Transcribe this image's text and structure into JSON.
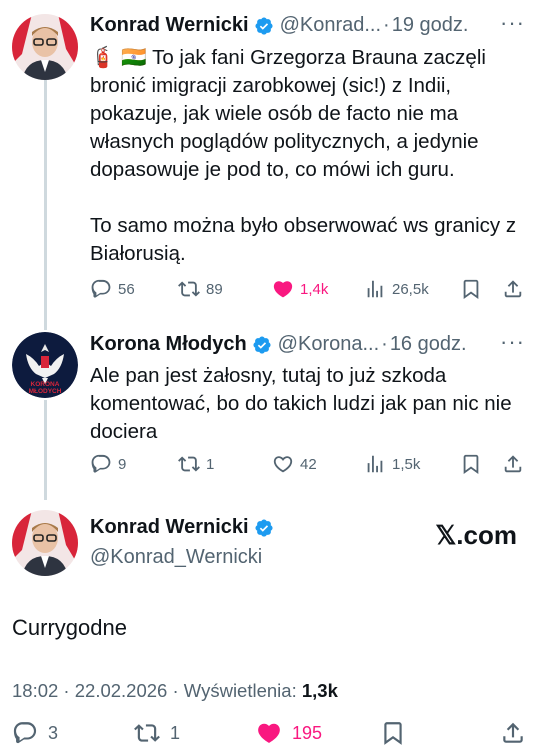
{
  "colors": {
    "text": "#0f1419",
    "muted": "#536471",
    "like": "#f91880",
    "verified": "#1d9bf0",
    "thread_line": "#cfd9de"
  },
  "tweet1": {
    "display_name": "Konrad Wernicki",
    "handle": "@Konrad...",
    "separator": "·",
    "time": "19 godz.",
    "flags": "🧯 🇮🇳",
    "text_line1": "To jak fani Grzegorza Brauna zaczęli bronić imigracji zarobkowej (sic!) z Indii, pokazuje, jak wiele osób de facto nie ma własnych poglądów politycznych, a jedynie dopasowuje je pod to, co mówi ich guru.",
    "text_line2": "To samo można było obserwować ws granicy z Białorusią.",
    "replies": "56",
    "retweets": "89",
    "likes": "1,4k",
    "views": "26,5k",
    "avatar_icon": "person-avatar"
  },
  "tweet2": {
    "display_name": "Korona Młodych",
    "handle": "@Korona...",
    "separator": "·",
    "time": "16 godz.",
    "text": "Ale pan jest żałosny, tutaj to już szkoda komentować, bo do takich ludzi jak pan nic nie dociera",
    "replies": "9",
    "retweets": "1",
    "likes": "42",
    "views": "1,5k",
    "avatar_icon": "eagle-crest-avatar",
    "avatar_text": "KORONA MŁODYCH"
  },
  "main_tweet": {
    "display_name": "Konrad Wernicki",
    "handle": "@Konrad_Wernicki",
    "site": "𝕏.com",
    "text": "Currygodne",
    "time": "18:02 · 22.02.2026 · ",
    "views_label": "Wyświetlenia: ",
    "views": "1,3k",
    "replies": "3",
    "retweets": "1",
    "likes": "195"
  },
  "icons": [
    "reply-icon",
    "retweet-icon",
    "like-icon",
    "views-icon",
    "bookmark-icon",
    "share-icon",
    "verified-icon",
    "more-icon"
  ]
}
